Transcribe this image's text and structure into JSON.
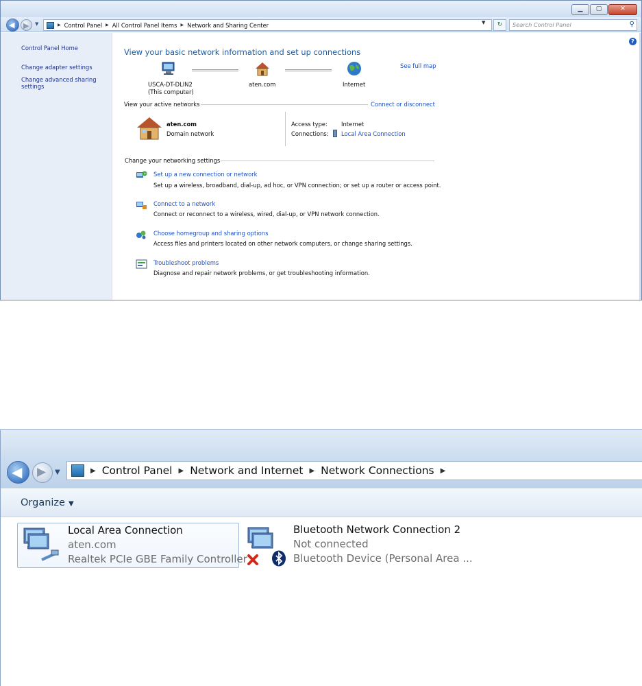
{
  "top_window": {
    "breadcrumb": [
      "Control Panel",
      "All Control Panel Items",
      "Network and Sharing Center"
    ],
    "search_placeholder": "Search Control Panel",
    "sidebar": {
      "home": "Control Panel Home",
      "links": [
        "Change adapter settings",
        "Change advanced sharing settings"
      ]
    },
    "heading": "View your basic network information and set up connections",
    "see_full_map": "See full map",
    "map": {
      "computer_name": "USCA-DT-DLIN2",
      "computer_caption": "(This computer)",
      "network": "aten.com",
      "internet": "Internet"
    },
    "active_networks": {
      "label": "View your active networks",
      "connect_link": "Connect or disconnect",
      "network_name": "aten.com",
      "network_type": "Domain network",
      "access_type_label": "Access type:",
      "access_type_value": "Internet",
      "connections_label": "Connections:",
      "connections_value": "Local Area Connection"
    },
    "change_settings": {
      "label": "Change your networking settings",
      "tasks": [
        {
          "title": "Set up a new connection or network",
          "desc": "Set up a wireless, broadband, dial-up, ad hoc, or VPN connection; or set up a router or access point.",
          "icon": "new-connection-icon"
        },
        {
          "title": "Connect to a network",
          "desc": "Connect or reconnect to a wireless, wired, dial-up, or VPN network connection.",
          "icon": "connect-network-icon"
        },
        {
          "title": "Choose homegroup and sharing options",
          "desc": "Access files and printers located on other network computers, or change sharing settings.",
          "icon": "homegroup-icon"
        },
        {
          "title": "Troubleshoot problems",
          "desc": "Diagnose and repair network problems, or get troubleshooting information.",
          "icon": "troubleshoot-icon"
        }
      ]
    }
  },
  "bottom_window": {
    "breadcrumb": [
      "Control Panel",
      "Network and Internet",
      "Network Connections"
    ],
    "toolbar": {
      "organize": "Organize"
    },
    "connections": [
      {
        "name": "Local Area Connection",
        "network": "aten.com",
        "device": "Realtek PCIe GBE Family Controller",
        "selected": true
      },
      {
        "name": "Bluetooth Network Connection 2",
        "network": "Not connected",
        "device": "Bluetooth Device (Personal Area ...",
        "selected": false
      }
    ]
  },
  "colors": {
    "link": "#1e51c9",
    "heading": "#1e5b9e",
    "sidebar_bg": "#e7eef8",
    "chrome": "#c9dbef"
  }
}
